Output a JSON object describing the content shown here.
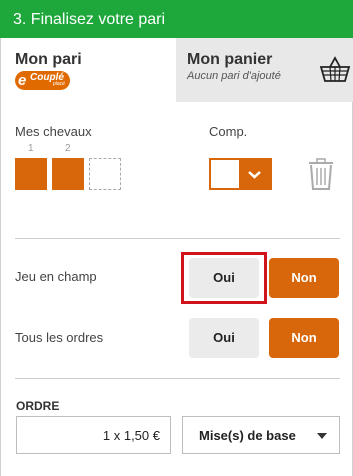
{
  "header": {
    "title": "3. Finalisez votre pari"
  },
  "tabs": {
    "bet": {
      "title": "Mon pari",
      "badge_e": "e",
      "badge_label": "Couplé",
      "badge_sub": "placé"
    },
    "cart": {
      "title": "Mon panier",
      "subtitle": "Aucun pari d'ajouté"
    }
  },
  "horses": {
    "label": "Mes chevaux",
    "numbers": [
      "1",
      "2"
    ],
    "comp_label": "Comp."
  },
  "options": {
    "field_bet": {
      "label": "Jeu en champ",
      "yes": "Oui",
      "no": "Non"
    },
    "all_orders": {
      "label": "Tous les ordres",
      "yes": "Oui",
      "no": "Non"
    }
  },
  "order": {
    "title": "ORDRE",
    "amount": "1 x 1,50 €",
    "stake_select": "Mise(s) de base"
  },
  "colors": {
    "header_green": "#1ea83c",
    "accent_orange": "#d8670b",
    "highlight_red": "#d0141b"
  },
  "icons": [
    "basket-icon",
    "trash-icon",
    "chevron-down-icon",
    "caret-down-icon"
  ]
}
